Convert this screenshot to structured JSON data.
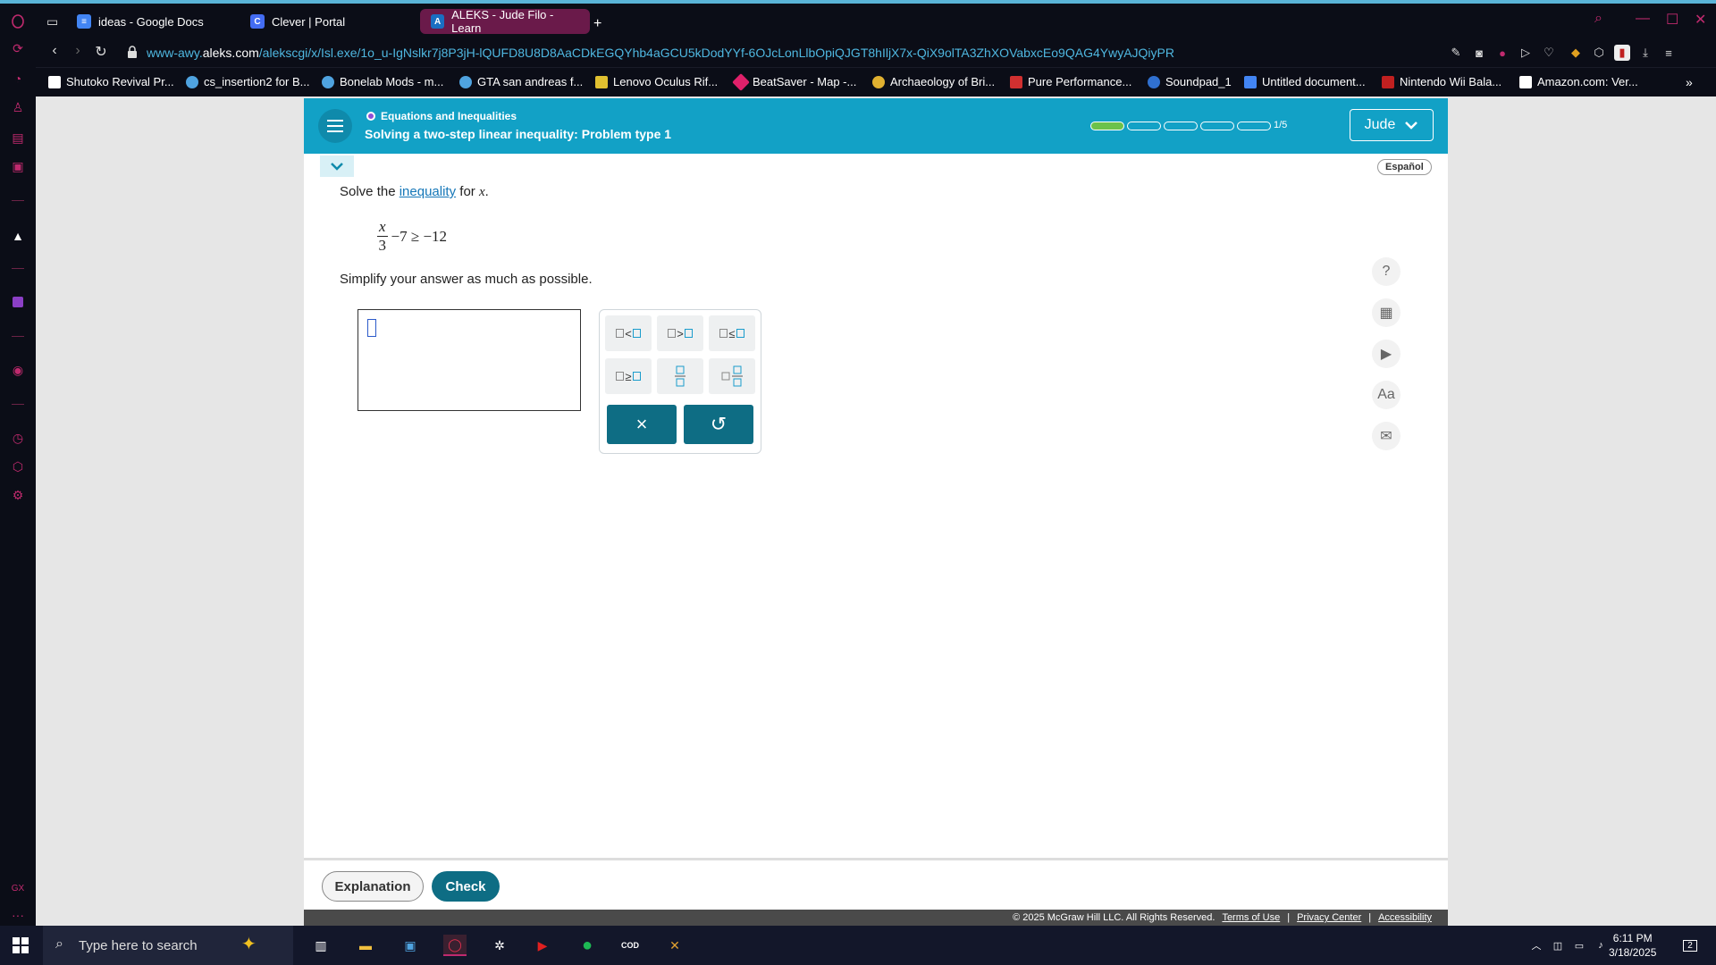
{
  "browser": {
    "tabs": [
      {
        "label": "ideas - Google Docs",
        "icon": "docs-icon",
        "color": "#4285f4"
      },
      {
        "label": "Clever | Portal",
        "icon": "clever-icon",
        "color": "#436cf2"
      },
      {
        "label": "ALEKS - Jude Filo - Learn",
        "icon": "aleks-icon",
        "color": "#1a6fc2"
      }
    ],
    "url_host": "www-awy.",
    "url_domain": "aleks.com",
    "url_path": "/alekscgi/x/Isl.exe/1o_u-IgNslkr7j8P3jH-lQUFD8U8D8AaCDkEGQYhb4aGCU5kDodYYf-6OJcLonLlbOpiQJGT8hIljX7x-QiX9olTA3ZhXOVabxcEo9QAG4YwyAJQiyPR",
    "bookmarks": [
      {
        "label": "Shutoko Revival Pr...",
        "color": "#ffffff"
      },
      {
        "label": "cs_insertion2 for B...",
        "color": "#4fa3e0"
      },
      {
        "label": "Bonelab Mods - m...",
        "color": "#4fa3e0"
      },
      {
        "label": "GTA san andreas f...",
        "color": "#4fa3e0"
      },
      {
        "label": "Lenovo Oculus Rif...",
        "color": "#e0c030"
      },
      {
        "label": "BeatSaver - Map -...",
        "color": "#e0206a"
      },
      {
        "label": "Archaeology of Bri...",
        "color": "#e0b030"
      },
      {
        "label": "Pure Performance...",
        "color": "#d03030"
      },
      {
        "label": "Soundpad_1",
        "color": "#3070d0"
      },
      {
        "label": "Untitled document...",
        "color": "#4285f4"
      },
      {
        "label": "Nintendo Wii Bala...",
        "color": "#c02020"
      },
      {
        "label": "Amazon.com: Ver...",
        "color": "#ffffff"
      }
    ]
  },
  "aleks": {
    "topic": "Equations and Inequalities",
    "title": "Solving a two-step linear inequality: Problem type 1",
    "progress_text": "1/5",
    "progress_done": 1,
    "progress_total": 5,
    "user": "Jude",
    "espanol": "Español",
    "question": {
      "prefix": "Solve the ",
      "link": "inequality",
      "middle": " for ",
      "var": "x",
      "suffix": ".",
      "eq_num": "x",
      "eq_den": "3",
      "eq_rest": "−7 ≥ −12",
      "instruction": "Simplify your answer as much as possible."
    },
    "keypad": {
      "lt": "<",
      "gt": ">",
      "le": "≤",
      "ge": "≥",
      "clear": "×",
      "undo": "↺"
    },
    "buttons": {
      "explanation": "Explanation",
      "check": "Check"
    },
    "footer": {
      "copyright": "© 2025 McGraw Hill LLC. All Rights Reserved.",
      "terms": "Terms of Use",
      "privacy": "Privacy Center",
      "accessibility": "Accessibility",
      "sep": "|"
    }
  },
  "taskbar": {
    "search_placeholder": "Type here to search",
    "time": "6:11 PM",
    "date": "3/18/2025",
    "notifications": "2"
  }
}
